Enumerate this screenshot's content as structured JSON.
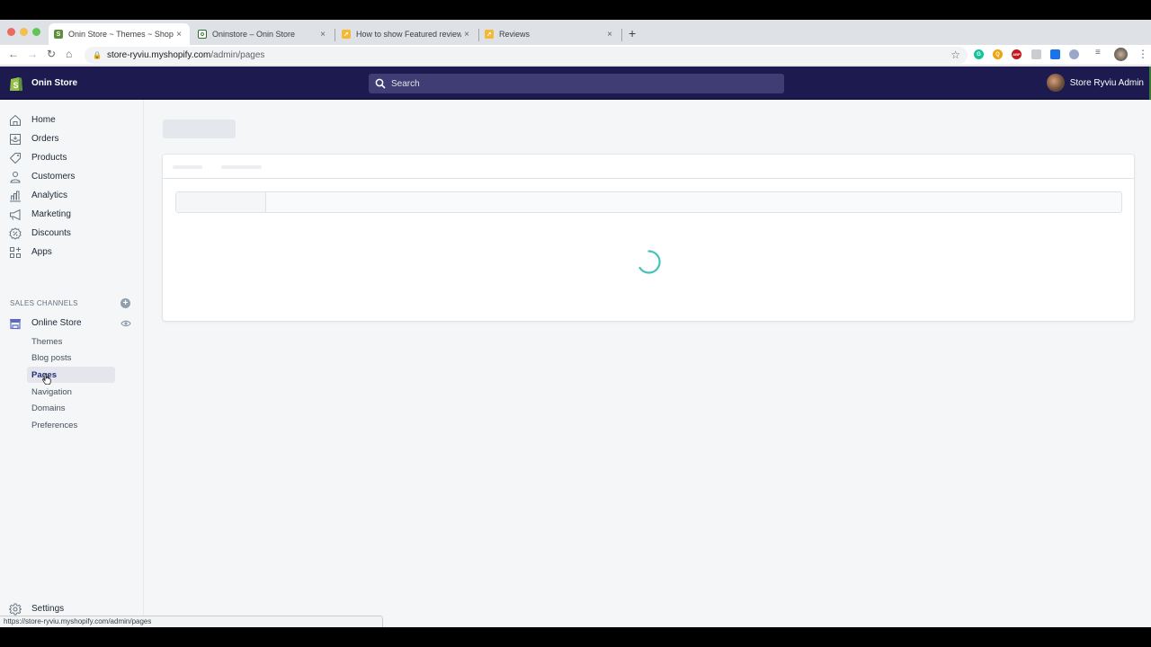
{
  "browser": {
    "tabs": [
      {
        "title": "Onin Store ~ Themes ~ Shopify",
        "favicon": "shopify-icon",
        "favicon_color": "#5e8e3e",
        "active": true
      },
      {
        "title": "Oninstore – Onin Store",
        "favicon": "store-icon",
        "favicon_color": "#2c6e2f",
        "active": false
      },
      {
        "title": "How to show Featured reviews",
        "favicon": "ryviu-icon",
        "favicon_color": "#f5b82e",
        "active": false
      },
      {
        "title": "Reviews",
        "favicon": "ryviu-icon",
        "favicon_color": "#f5b82e",
        "active": false
      }
    ],
    "close_glyph": "×",
    "new_tab_glyph": "+",
    "url_host": "store-ryviu.myshopify.com",
    "url_path": "/admin/pages",
    "extensions": [
      {
        "name": "grammarly-icon",
        "color": "#15c39a",
        "glyph": "G"
      },
      {
        "name": "search-extension-icon",
        "color": "#f0a30a",
        "glyph": "Q"
      },
      {
        "name": "adblock-icon",
        "color": "#c3181f",
        "glyph": "ABP"
      },
      {
        "name": "extension-icon",
        "color": "#c9ccd1",
        "glyph": ""
      },
      {
        "name": "extension-blue-icon",
        "color": "#1a73e8",
        "glyph": ""
      },
      {
        "name": "extension-avatar-icon",
        "color": "#9aa7c7",
        "glyph": ""
      }
    ],
    "status_url": "https://store-ryviu.myshopify.com/admin/pages"
  },
  "topbar": {
    "store_name": "Onin Store",
    "search_placeholder": "Search",
    "user_name": "Store Ryviu Admin",
    "bg_color": "#1c1a4e"
  },
  "sidebar": {
    "items": [
      {
        "label": "Home",
        "icon": "home-icon"
      },
      {
        "label": "Orders",
        "icon": "orders-icon"
      },
      {
        "label": "Products",
        "icon": "tag-icon"
      },
      {
        "label": "Customers",
        "icon": "customer-icon"
      },
      {
        "label": "Analytics",
        "icon": "analytics-icon"
      },
      {
        "label": "Marketing",
        "icon": "megaphone-icon"
      },
      {
        "label": "Discounts",
        "icon": "discount-icon"
      },
      {
        "label": "Apps",
        "icon": "apps-icon"
      }
    ],
    "sales_channels_heading": "SALES CHANNELS",
    "online_store": {
      "label": "Online Store",
      "sub_items": [
        {
          "label": "Themes",
          "active": false
        },
        {
          "label": "Blog posts",
          "active": false
        },
        {
          "label": "Pages",
          "active": true
        },
        {
          "label": "Navigation",
          "active": false
        },
        {
          "label": "Domains",
          "active": false
        },
        {
          "label": "Preferences",
          "active": false
        }
      ]
    },
    "settings_label": "Settings"
  },
  "main": {
    "state": "loading",
    "spinner_color": "#47c1bf"
  }
}
